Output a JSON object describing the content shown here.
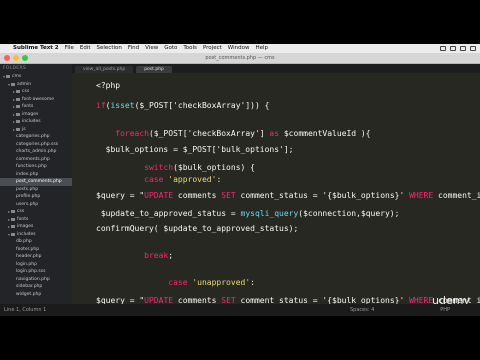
{
  "menubar": {
    "apple": "",
    "items": [
      "Sublime Text 2",
      "File",
      "Edit",
      "Selection",
      "Find",
      "View",
      "Goto",
      "Tools",
      "Project",
      "Window",
      "Help"
    ]
  },
  "window": {
    "title": "post_comments.php — cms"
  },
  "sidebar": {
    "header": "FOLDERS",
    "items": [
      {
        "label": "cms",
        "depth": 0,
        "expanded": true,
        "folder": true
      },
      {
        "label": "admin",
        "depth": 1,
        "expanded": true,
        "folder": true
      },
      {
        "label": "css",
        "depth": 2,
        "expanded": false,
        "folder": true
      },
      {
        "label": "font-awesome",
        "depth": 2,
        "expanded": false,
        "folder": true
      },
      {
        "label": "fonts",
        "depth": 2,
        "expanded": false,
        "folder": true
      },
      {
        "label": "images",
        "depth": 2,
        "expanded": false,
        "folder": true
      },
      {
        "label": "includes",
        "depth": 2,
        "expanded": false,
        "folder": true
      },
      {
        "label": "js",
        "depth": 2,
        "expanded": false,
        "folder": true
      },
      {
        "label": "categories.php",
        "depth": 2,
        "folder": false
      },
      {
        "label": "categories.php.sss",
        "depth": 2,
        "folder": false
      },
      {
        "label": "charts_admin.php",
        "depth": 2,
        "folder": false
      },
      {
        "label": "comments.php",
        "depth": 2,
        "folder": false
      },
      {
        "label": "functions.php",
        "depth": 2,
        "folder": false
      },
      {
        "label": "index.php",
        "depth": 2,
        "folder": false
      },
      {
        "label": "post_comments.php",
        "depth": 2,
        "folder": false,
        "active": true
      },
      {
        "label": "posts.php",
        "depth": 2,
        "folder": false
      },
      {
        "label": "profile.php",
        "depth": 2,
        "folder": false
      },
      {
        "label": "users.php",
        "depth": 2,
        "folder": false
      },
      {
        "label": "css",
        "depth": 1,
        "expanded": false,
        "folder": true
      },
      {
        "label": "fonts",
        "depth": 1,
        "expanded": false,
        "folder": true
      },
      {
        "label": "images",
        "depth": 1,
        "expanded": false,
        "folder": true
      },
      {
        "label": "includes",
        "depth": 1,
        "expanded": true,
        "folder": true
      },
      {
        "label": "db.php",
        "depth": 2,
        "folder": false
      },
      {
        "label": "footer.php",
        "depth": 2,
        "folder": false
      },
      {
        "label": "header.php",
        "depth": 2,
        "folder": false
      },
      {
        "label": "login.php",
        "depth": 2,
        "folder": false
      },
      {
        "label": "login.php.sss",
        "depth": 2,
        "folder": false
      },
      {
        "label": "navigation.php",
        "depth": 2,
        "folder": false
      },
      {
        "label": "sidebar.php",
        "depth": 2,
        "folder": false
      },
      {
        "label": "widget.php",
        "depth": 2,
        "folder": false
      }
    ]
  },
  "tabs": [
    {
      "label": "view_all_posts.php",
      "active": false
    },
    {
      "label": "post.php",
      "active": true
    }
  ],
  "code": {
    "lines": [
      [
        [
          "pl",
          "<?php"
        ]
      ],
      [
        [
          "kw",
          "if"
        ],
        [
          "pl",
          "("
        ],
        [
          "fn",
          "isset"
        ],
        [
          "pl",
          "($_POST['checkBoxArray'])) {"
        ]
      ],
      [],
      [
        [
          "pl",
          "    "
        ],
        [
          "kw",
          "foreach"
        ],
        [
          "pl",
          "($_POST['checkBoxArray'] "
        ],
        [
          "kw",
          "as"
        ],
        [
          "pl",
          " $commentValueId ){"
        ]
      ],
      [
        [
          "pl",
          "  $bulk_options = $_POST['bulk_options'];"
        ]
      ],
      [
        [
          "pl",
          "          "
        ],
        [
          "kw",
          "switch"
        ],
        [
          "pl",
          "($bulk_options) {"
        ]
      ],
      [
        [
          "pl",
          "          "
        ],
        [
          "kw",
          "case"
        ],
        [
          "pl",
          " "
        ],
        [
          "str",
          "'approved'"
        ],
        [
          "pl",
          ":"
        ]
      ],
      [
        [
          "pl",
          "$query = \""
        ],
        [
          "kw",
          "UPDATE"
        ],
        [
          "pl",
          " comments "
        ],
        [
          "kw",
          "SET"
        ],
        [
          "pl",
          " comment_status = '{$bulk_options}' "
        ],
        [
          "kw",
          "WHERE"
        ],
        [
          "pl",
          " comment_id"
        ]
      ],
      [
        [
          "pl",
          " $update_to_approved_status = "
        ],
        [
          "fn",
          "mysqli_query"
        ],
        [
          "pl",
          "($connection,$query);"
        ]
      ],
      [
        [
          "pl",
          "confirmQuery( $update_to_approved_status);"
        ]
      ],
      [],
      [
        [
          "pl",
          "          "
        ],
        [
          "kw",
          "break"
        ],
        [
          "pl",
          ";"
        ]
      ],
      [],
      [
        [
          "pl",
          "               "
        ],
        [
          "kw",
          "case"
        ],
        [
          "pl",
          " "
        ],
        [
          "str",
          "'unapproved'"
        ],
        [
          "pl",
          ":"
        ]
      ],
      [
        [
          "pl",
          "$query = \""
        ],
        [
          "kw",
          "UPDATE"
        ],
        [
          "pl",
          " comments "
        ],
        [
          "kw",
          "SET"
        ],
        [
          "pl",
          " comment_status = '{$bulk_options}' "
        ],
        [
          "kw",
          "WHERE"
        ],
        [
          "pl",
          " comment_id"
        ]
      ]
    ]
  },
  "statusbar": {
    "left": "Line 1, Column 1",
    "mid": "Spaces: 4",
    "right": "PHP"
  },
  "watermark": "udemy",
  "colors": {
    "editor_bg": "#272822",
    "keyword": "#f92672",
    "function": "#66d9ef",
    "string": "#e6db74",
    "text": "#f8f8f2",
    "close": "#fc605c",
    "minimize": "#fdbc40",
    "zoom": "#34c84a"
  }
}
